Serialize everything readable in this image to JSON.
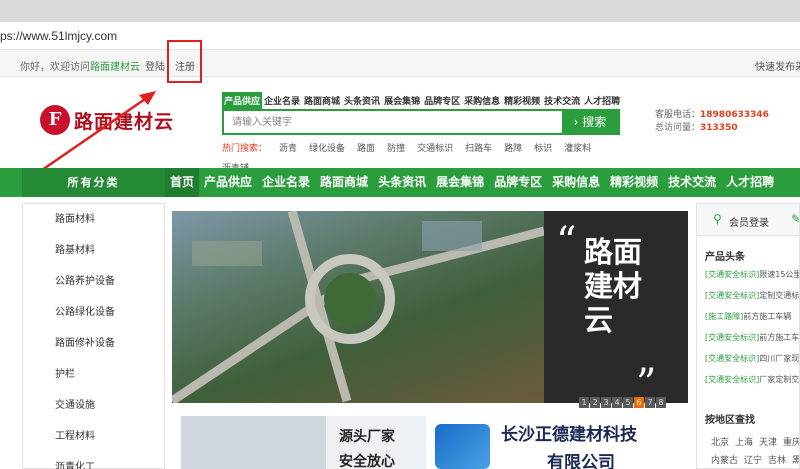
{
  "url": "ps://www.51lmjcy.com",
  "topbar": {
    "welcome_prefix": "你好，欢迎访问",
    "site_name": "路面建材云",
    "login": "登陆",
    "register": "注册",
    "publish": "快速发布采购"
  },
  "logo": {
    "mark": "F",
    "name": "路面建材云"
  },
  "search": {
    "tabs": [
      "产品供应",
      "企业名录",
      "路面商城",
      "头条资讯",
      "展会集锦",
      "品牌专区",
      "采购信息",
      "精彩视频",
      "技术交流",
      "人才招聘"
    ],
    "active_tab": 0,
    "placeholder": "请输入关键字",
    "button": "搜索",
    "hot_label": "热门搜索：",
    "hot_keywords": [
      "沥青",
      "绿化设备",
      "路面",
      "防撞",
      "交通标识",
      "扫路车",
      "路障",
      "标识",
      "灌浆料"
    ],
    "hot_extra": "沥青铺"
  },
  "contact": {
    "phone_label": "客服电话：",
    "phone": "18980633346",
    "visits_label": "总访问量：",
    "visits": "313350"
  },
  "nav": {
    "all_label": "所有分类",
    "items": [
      "首页",
      "产品供应",
      "企业名录",
      "路面商城",
      "头条资讯",
      "展会集锦",
      "品牌专区",
      "采购信息",
      "精彩视频",
      "技术交流",
      "人才招聘"
    ],
    "active": 0
  },
  "sidebar": [
    "路面材料",
    "路基材料",
    "公路养护设备",
    "公路绿化设备",
    "路面修补设备",
    "护栏",
    "交通设施",
    "工程材料",
    "沥青化工"
  ],
  "banner": {
    "slogan": "路面建材云",
    "quote_open": "“",
    "quote_close": "”",
    "pages": [
      "1",
      "2",
      "3",
      "4",
      "5",
      "6",
      "7",
      "8"
    ],
    "active_page": 5
  },
  "ads": {
    "ad1_line1": "源头厂家",
    "ad1_line2": "安全放心",
    "ad2_line1": "长沙正德建材科技",
    "ad2_line2": "有限公司"
  },
  "right_panel": {
    "login_label": "会员登录",
    "news_title": "产品头条",
    "news": [
      {
        "tag": "[交通安全标识]",
        "text": "限速15公里"
      },
      {
        "tag": "[交通安全标识]",
        "text": "定制交通标"
      },
      {
        "tag": "[施工路障]",
        "text": "前方施工车辆"
      },
      {
        "tag": "[交通安全标识]",
        "text": "前方施工车"
      },
      {
        "tag": "[交通安全标识]",
        "text": "四川厂家现"
      },
      {
        "tag": "[交通安全标识]",
        "text": "厂家定制交"
      }
    ],
    "region_title": "按地区查找",
    "regions_row1": [
      "北京",
      "上海",
      "天津",
      "重庆"
    ],
    "regions_row2": [
      "内蒙古",
      "辽宁",
      "吉林",
      "黑龙"
    ]
  },
  "colors": {
    "brand_green": "#2a9d3d",
    "logo_red": "#b0101e",
    "highlight_red": "#e02020"
  }
}
